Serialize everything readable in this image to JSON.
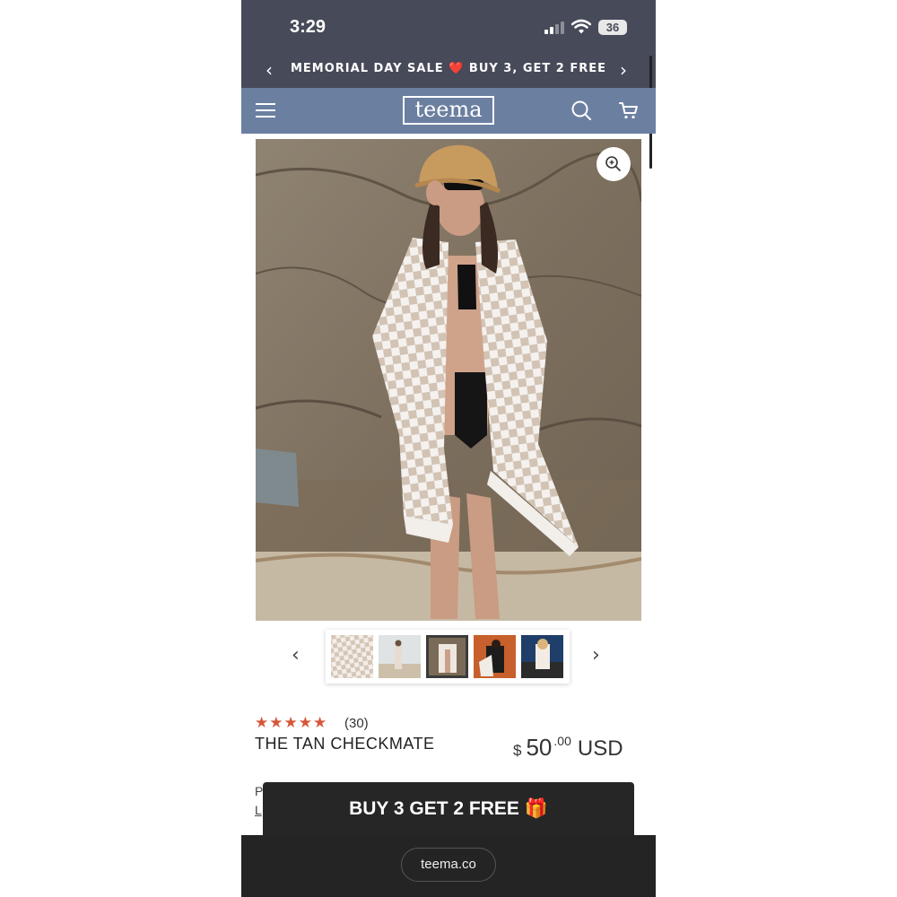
{
  "status_bar": {
    "time": "3:29",
    "battery": "36"
  },
  "announcement": {
    "text_before": "MEMORIAL DAY SALE",
    "heart": "❤️",
    "text_after": "BUY 3, GET 2 FREE"
  },
  "header": {
    "logo": "teema"
  },
  "product": {
    "title": "THE TAN CHECKMATE",
    "rating": 5,
    "review_count": "(30)",
    "price": {
      "currency_symbol": "$",
      "amount": "50",
      "cents": ".00",
      "currency": "USD"
    },
    "partial_line_1": "P",
    "partial_line_2": "L"
  },
  "promo": {
    "text": "BUY 3 GET 2 FREE",
    "emoji": "🎁"
  },
  "browser": {
    "url": "teema.co"
  },
  "colors": {
    "status_bg": "#474a59",
    "header_bg": "#6b7fa0",
    "star": "#d5573b",
    "promo_bg": "#262626"
  },
  "icons": [
    "chevron-left-icon",
    "chevron-right-icon",
    "menu-icon",
    "search-icon",
    "cart-icon",
    "zoom-icon",
    "star-icon"
  ]
}
